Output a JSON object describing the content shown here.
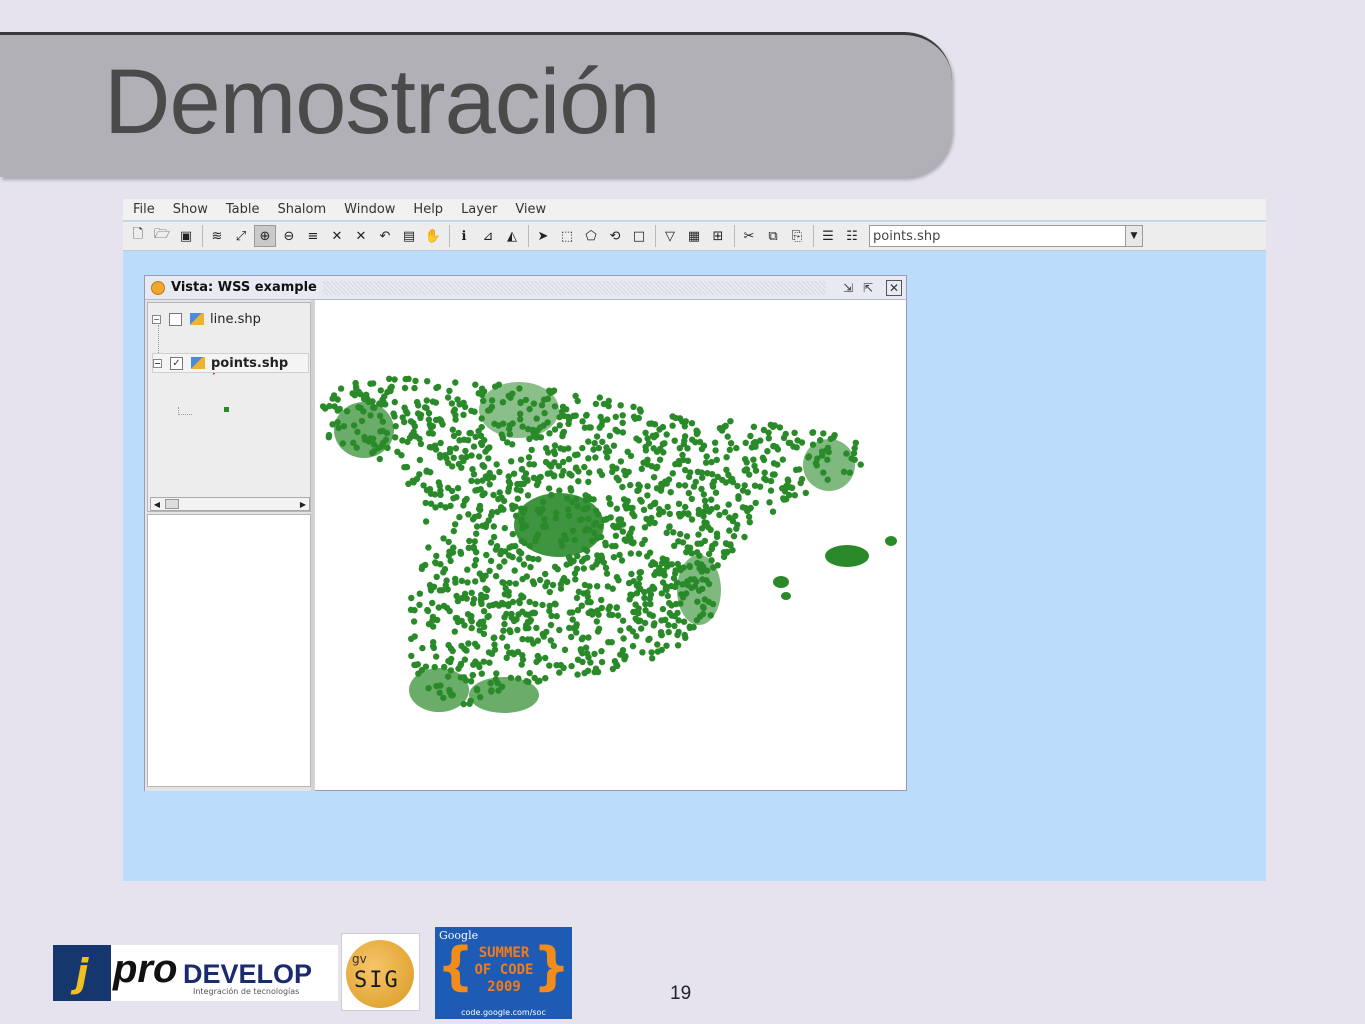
{
  "slide": {
    "title": "Demostración",
    "page_number": "19"
  },
  "app": {
    "menu": [
      "File",
      "Show",
      "Table",
      "Shalom",
      "Window",
      "Help",
      "Layer",
      "View"
    ],
    "toolbar_icons": [
      "new-file-icon",
      "open-folder-icon",
      "save-icon",
      "add-layer-icon",
      "zoom-full-icon",
      "zoom-in-icon",
      "zoom-out-icon",
      "layers-icon",
      "zoom-extent-icon",
      "zoom-select-icon",
      "zoom-previous-icon",
      "frame-icon",
      "pan-hand-icon",
      "info-icon",
      "measure-icon",
      "area-icon",
      "select-arrow-icon",
      "select-rect-icon",
      "select-poly-icon",
      "invert-select-icon",
      "clear-select-icon",
      "filter-icon",
      "table-icon",
      "locator-icon",
      "tools-icon",
      "copy-icon",
      "paste-icon",
      "stack-icon",
      "list-icon"
    ],
    "selected_layer": "points.shp",
    "colors": {
      "desktop": "#bcdcfb",
      "points": "#2a8a2a",
      "line_legend": "#d02020"
    }
  },
  "view": {
    "title": "Vista: WSS example",
    "layers": [
      {
        "name": "line.shp",
        "checked": false
      },
      {
        "name": "points.shp",
        "checked": true
      }
    ]
  },
  "footer": {
    "prodevelop_mark": "j",
    "prodevelop_pro": "pro",
    "prodevelop_develop": "DEVELOP",
    "prodevelop_sub": "Integración de tecnologías",
    "gvsig_gv": "gv",
    "gvsig_text": "SIG",
    "soc_google": "Google",
    "soc_lines": [
      "SUMMER",
      "OF CODE",
      "2009"
    ],
    "soc_url": "code.google.com/soc"
  }
}
